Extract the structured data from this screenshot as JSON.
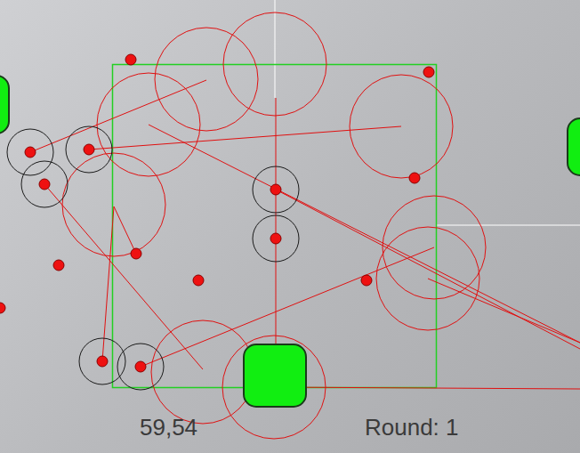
{
  "hud": {
    "score": "59,54",
    "round": "Round: 1"
  },
  "agents": [
    {
      "highlighted": false
    },
    {
      "highlighted": false
    },
    {
      "highlighted": true
    },
    {
      "highlighted": true
    },
    {
      "highlighted": true
    },
    {
      "highlighted": false
    },
    {
      "highlighted": true
    },
    {
      "highlighted": true
    },
    {
      "highlighted": false
    },
    {
      "highlighted": false
    },
    {
      "highlighted": false
    },
    {
      "highlighted": false
    },
    {
      "highlighted": false
    },
    {
      "highlighted": true
    },
    {
      "highlighted": true
    }
  ]
}
